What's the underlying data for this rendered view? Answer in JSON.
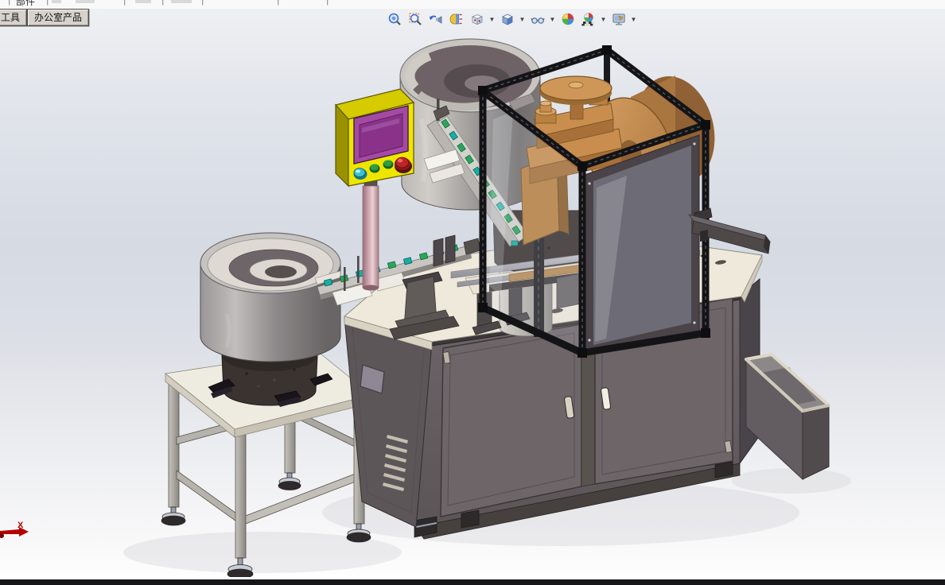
{
  "command_strip": {
    "partial_label": "部件",
    "note": "clipped bottom edge of CommandManager toolbar row"
  },
  "tabs": [
    {
      "label": "工具"
    },
    {
      "label": "办公室产品"
    }
  ],
  "headsup_toolbar": {
    "buttons": [
      {
        "name": "zoom-to-fit"
      },
      {
        "name": "zoom-to-area"
      },
      {
        "name": "previous-view"
      },
      {
        "name": "section-view"
      },
      {
        "name": "view-orientation",
        "has_dropdown": true
      },
      {
        "name": "display-style",
        "has_dropdown": true
      },
      {
        "name": "hide-show-items",
        "has_dropdown": true
      },
      {
        "name": "edit-appearance"
      },
      {
        "name": "apply-scene",
        "has_dropdown": true
      },
      {
        "name": "view-settings",
        "has_dropdown": true
      }
    ]
  },
  "viewport": {
    "triad_x_label": "X",
    "background_top": "#f0f1f4",
    "background_middle": "#d5dae3",
    "background_bottom": "#ffffff"
  },
  "model_colors": {
    "cabinet_taupe": "#665e62",
    "tabletop_cream": "#efe9dc",
    "control_box_yellow": "#efe600",
    "screen_purple": "#a44aa3",
    "frame_black": "#141416",
    "press_copper": "#c98e4e",
    "track_green": "#2ba55e",
    "clip_teal": "#14b0a4",
    "pole_pink": "#d9b3bb",
    "estop_red": "#c22222",
    "triad_red": "#b40000"
  }
}
